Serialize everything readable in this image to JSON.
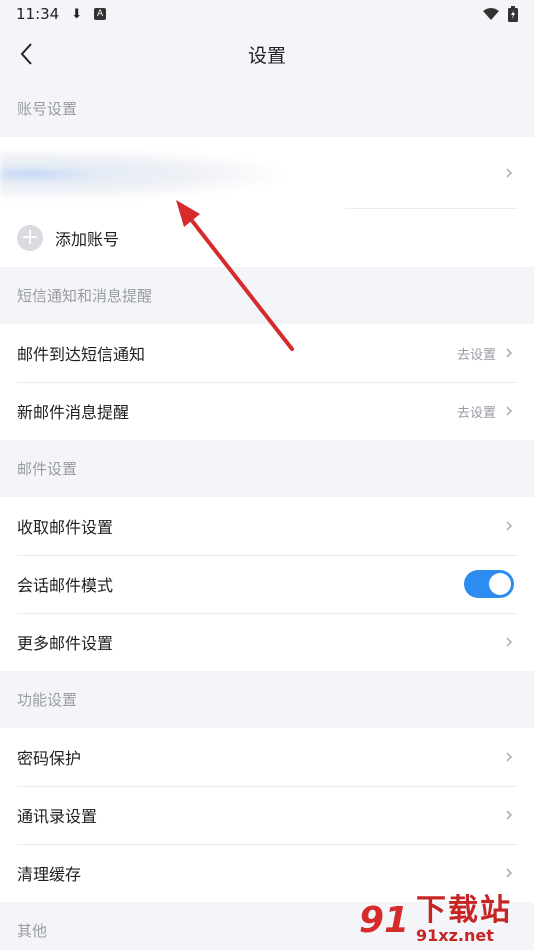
{
  "status_bar": {
    "time": "11:34",
    "download_icon_glyph": "⬇",
    "a_icon_glyph": "A",
    "wifi_icon": "wifi-icon",
    "battery_icon": "battery-charging-icon"
  },
  "nav": {
    "title": "设置",
    "back_icon": "chevron-left-icon"
  },
  "sections": {
    "account": {
      "header": "账号设置",
      "add_icon_glyph": "+",
      "add_label": "添加账号"
    },
    "sms": {
      "header": "短信通知和消息提醒",
      "items": [
        {
          "label": "邮件到达短信通知",
          "hint": "去设置"
        },
        {
          "label": "新邮件消息提醒",
          "hint": "去设置"
        }
      ]
    },
    "mail": {
      "header": "邮件设置",
      "items": [
        {
          "label": "收取邮件设置"
        },
        {
          "label": "会话邮件模式",
          "toggle_on": true
        },
        {
          "label": "更多邮件设置"
        }
      ]
    },
    "feature": {
      "header": "功能设置",
      "items": [
        {
          "label": "密码保护"
        },
        {
          "label": "通讯录设置"
        },
        {
          "label": "清理缓存"
        }
      ]
    },
    "other": {
      "header": "其他"
    }
  },
  "watermark": {
    "logo": "91",
    "main": "下载站",
    "sub": "91xz.net"
  },
  "colors": {
    "accent": "#2d8cf0",
    "annotation_arrow": "#d62b2b",
    "background": "#f4f5f9"
  }
}
